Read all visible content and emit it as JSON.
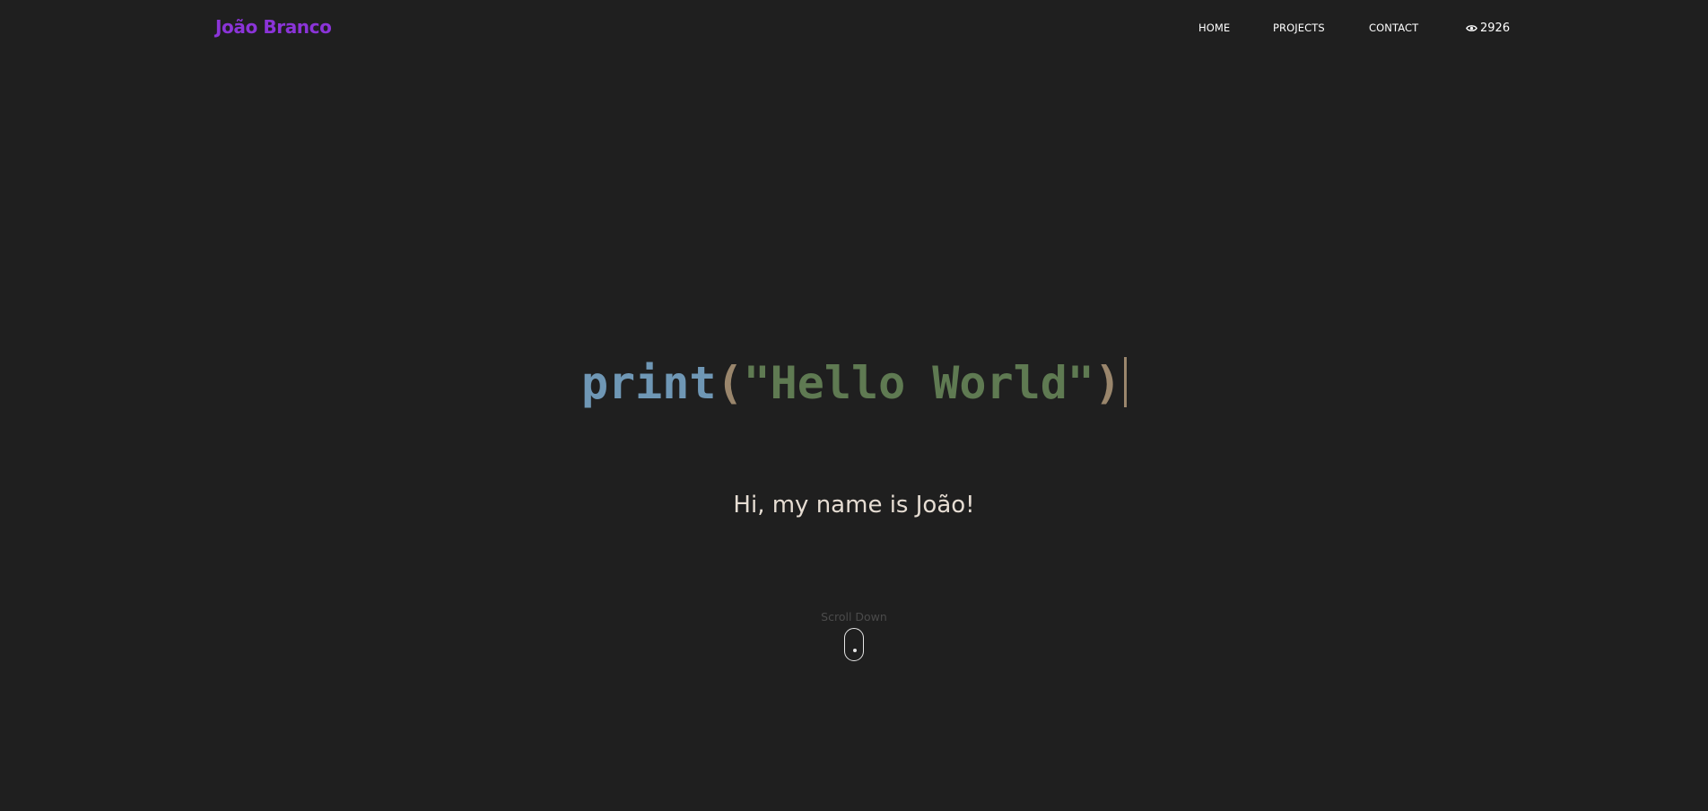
{
  "nav": {
    "brand": "João Branco",
    "items": [
      {
        "label": "HOME"
      },
      {
        "label": "PROJECTS"
      },
      {
        "label": "CONTACT"
      }
    ],
    "views": {
      "icon": "eye-icon",
      "count": "2926"
    }
  },
  "hero": {
    "code": {
      "function": "print",
      "open_paren": "(",
      "string": "\"Hello World\"",
      "close_paren": ")"
    },
    "greeting": "Hi, my name is João!"
  },
  "scroll": {
    "label": "Scroll Down",
    "icon": "mouse-icon"
  },
  "colors": {
    "background": "#1f1f1f",
    "brand": "#8b34d8",
    "code_function": "#6f97b5",
    "code_paren": "#9a866c",
    "code_string": "#5f7a52",
    "greeting": "#e6ddd3"
  }
}
